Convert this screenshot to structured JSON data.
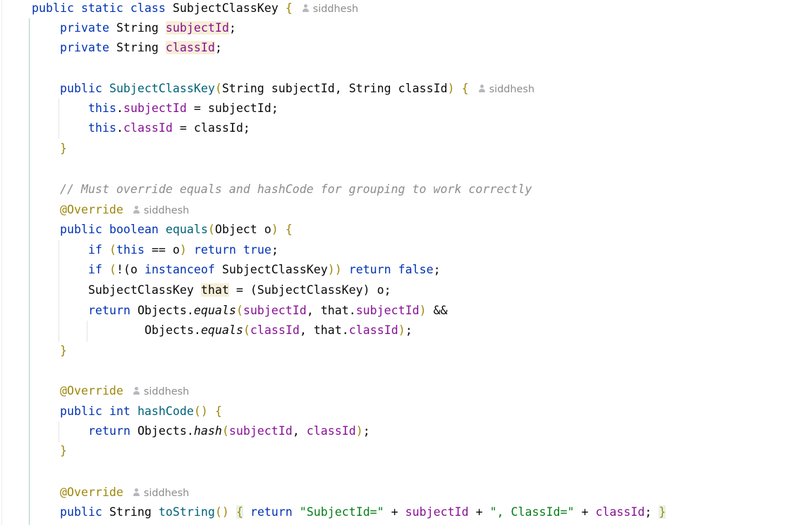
{
  "author_hint": "siddhesh",
  "code": {
    "class_decl": {
      "kw1": "public",
      "kw2": "static",
      "kw3": "class",
      "name": "SubjectClassKey",
      "open": "{"
    },
    "fields": [
      {
        "kw": "private",
        "type": "String",
        "name": "subjectId",
        "semi": ";"
      },
      {
        "kw": "private",
        "type": "String",
        "name": "classId",
        "semi": ";"
      }
    ],
    "ctor": {
      "kw": "public",
      "name": "SubjectClassKey",
      "lparen": "(",
      "p1type": "String",
      "p1name": "subjectId",
      "comma": ",",
      "p2type": "String",
      "p2name": "classId",
      "rparen": ")",
      "open": "{",
      "body": [
        {
          "this": "this",
          "dot": ".",
          "field": "subjectId",
          "rest": " = subjectId;"
        },
        {
          "this": "this",
          "dot": ".",
          "field": "classId",
          "rest": " = classId;"
        }
      ],
      "close": "}"
    },
    "comment": "// Must override equals and hashCode for grouping to work correctly",
    "annotation": "@Override",
    "equals": {
      "kw1": "public",
      "kw2": "boolean",
      "name": "equals",
      "lparen": "(",
      "params": "Object o",
      "rparen": ")",
      "open": "{",
      "l1": {
        "if": "if",
        "lp": "(",
        "this": "this",
        "mid": " == o",
        "rp": ")",
        "ret": "return",
        "val": "true",
        "semi": ";"
      },
      "l2": {
        "if": "if",
        "lp": "(",
        "bang": "!(o ",
        "inst": "instanceof",
        "type": " SubjectClassKey",
        "rp": "))",
        "ret": "return",
        "val": "false",
        "semi": ";"
      },
      "l3": {
        "type": "SubjectClassKey",
        "var": "that",
        "rest": " = (SubjectClassKey) o;"
      },
      "l4": {
        "ret": "return",
        "obj": " Objects.",
        "method": "equals",
        "lp": "(",
        "a1": "subjectId",
        "sep": ", that.",
        "a2": "subjectId",
        "rp": ")",
        "op": " &&"
      },
      "l5": {
        "obj": "Objects.",
        "method": "equals",
        "lp": "(",
        "a1": "classId",
        "sep": ", that.",
        "a2": "classId",
        "rp": ")",
        "semi": ";"
      },
      "close": "}"
    },
    "hashCode": {
      "kw1": "public",
      "kw2": "int",
      "name": "hashCode",
      "parens": "()",
      "open": "{",
      "l1": {
        "ret": "return",
        "obj": " Objects.",
        "method": "hash",
        "lp": "(",
        "a1": "subjectId",
        "sep": ", ",
        "a2": "classId",
        "rp": ")",
        "semi": ";"
      },
      "close": "}"
    },
    "toString": {
      "kw1": "public",
      "type": "String",
      "name": "toString",
      "parens": "()",
      "open": "{",
      "ret": "return",
      "s1": "\"SubjectId=\"",
      "plus1": " + ",
      "a1": "subjectId",
      "plus2": " + ",
      "s2": "\", ClassId=\"",
      "plus3": " + ",
      "a2": "classId",
      "semi": ";",
      "close": "}"
    }
  }
}
